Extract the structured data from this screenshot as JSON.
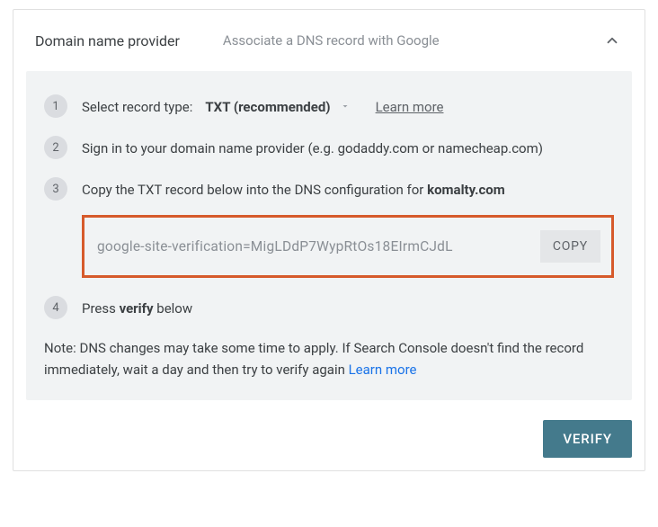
{
  "header": {
    "title": "Domain name provider",
    "subtitle": "Associate a DNS record with Google"
  },
  "steps": {
    "s1": {
      "num": "1",
      "label": "Select record type:",
      "dropdown": "TXT (recommended)",
      "learn": "Learn more"
    },
    "s2": {
      "num": "2",
      "text": "Sign in to your domain name provider (e.g. godaddy.com or namecheap.com)"
    },
    "s3": {
      "num": "3",
      "prefix": "Copy the TXT record below into the DNS configuration for ",
      "domain": "komalty.com",
      "record": "google-site-verification=MigLDdP7WypRtOs18EIrmCJdL",
      "copy": "COPY"
    },
    "s4": {
      "num": "4",
      "prefix": "Press ",
      "bold": "verify",
      "suffix": " below"
    }
  },
  "note": {
    "text": "Note: DNS changes may take some time to apply. If Search Console doesn't find the record immediately, wait a day and then try to verify again ",
    "link": "Learn more"
  },
  "footer": {
    "verify": "VERIFY"
  }
}
